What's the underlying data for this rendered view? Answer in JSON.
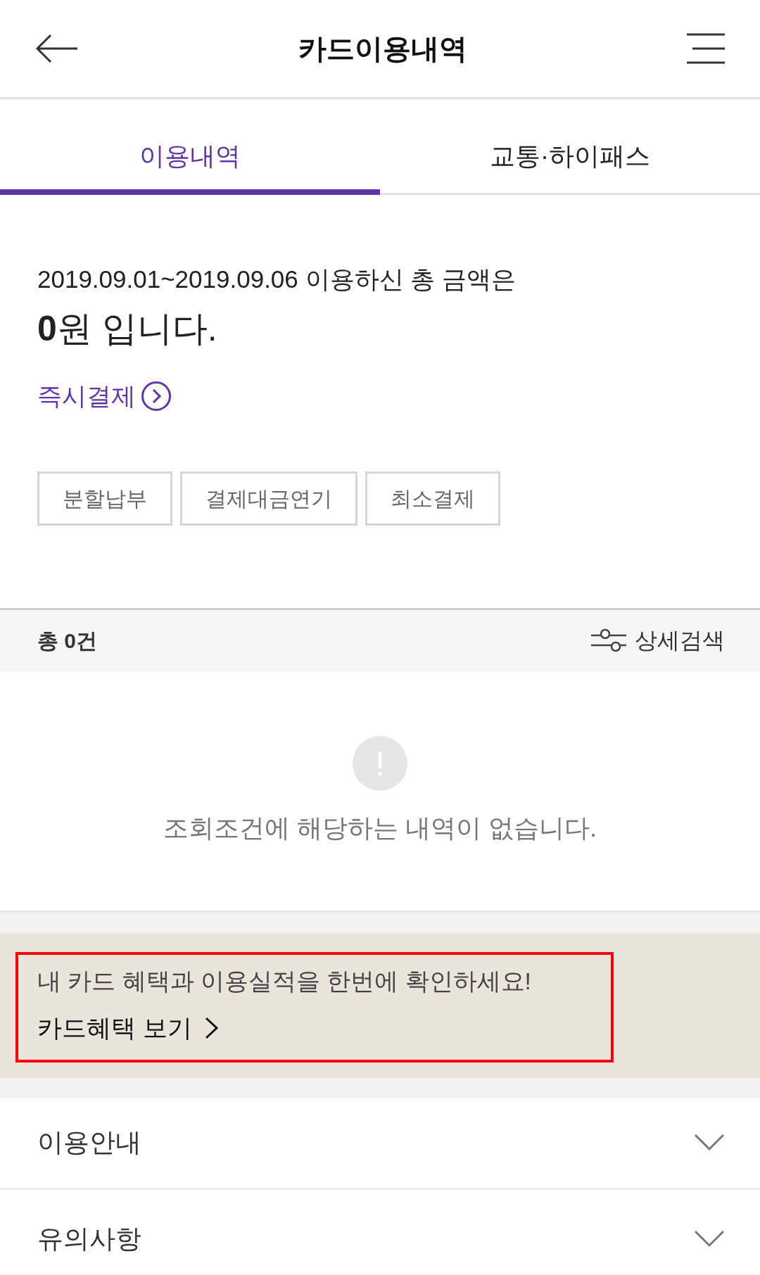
{
  "header": {
    "title": "카드이용내역"
  },
  "tabs": [
    {
      "label": "이용내역",
      "selected": true
    },
    {
      "label": "교통·하이패스",
      "selected": false
    }
  ],
  "summary": {
    "period_text": "2019.09.01~2019.09.06 이용하신 총 금액은",
    "amount_text": "**0**원 입니다.",
    "pay_link": "즉시결제"
  },
  "actions": [
    "분할납부",
    "결제대금연기",
    "최소결제"
  ],
  "list": {
    "count": "총 0건",
    "search_link": "상세검색",
    "empty_message": "조회조건에 해당하는 내역이 없습니다."
  },
  "benefit_banner": {
    "message": "내 카드 혜택과 이용실적을 한번에 확인하세요!",
    "link": "카드혜택 보기",
    "highlighted": true
  },
  "sections": [
    {
      "title": "이용안내",
      "expanded": false
    },
    {
      "title": "유의사항",
      "expanded": false
    }
  ]
}
